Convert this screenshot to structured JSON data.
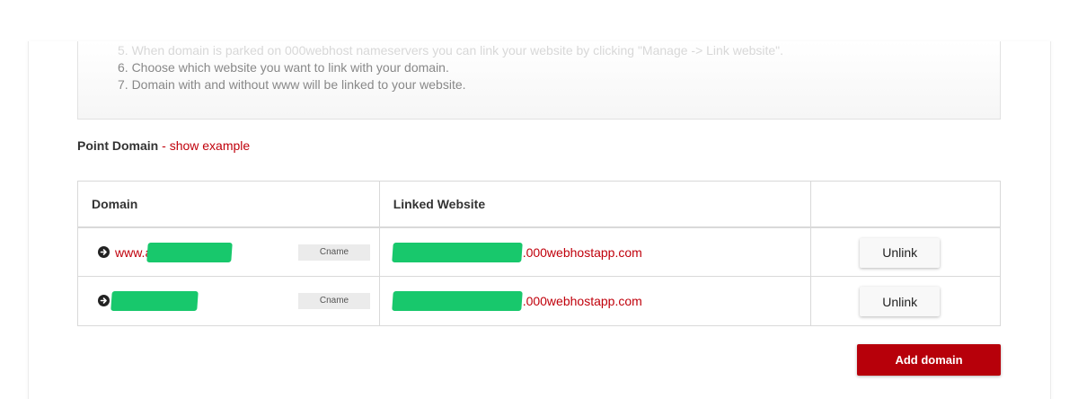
{
  "instructions": {
    "faded_step": "5. When domain is parked on 000webhost nameservers you can link your website by clicking \"Manage -> Link website\".",
    "steps": [
      "6. Choose which website you want to link with your domain.",
      "7. Domain with and without www will be linked to your website."
    ]
  },
  "point_domain": {
    "label": "Point Domain",
    "separator": " - ",
    "example_link": "show example"
  },
  "table": {
    "headers": [
      "Domain",
      "Linked Website",
      ""
    ],
    "rows": [
      {
        "domain_prefix": "www.a",
        "record_type": "Cname",
        "website_suffix": ".000webhostapp.com",
        "action": "Unlink"
      },
      {
        "domain_prefix": "",
        "record_type": "Cname",
        "website_suffix": ".000webhostapp.com",
        "action": "Unlink"
      }
    ]
  },
  "add_domain_label": "Add domain",
  "colors": {
    "accent": "#c0000b",
    "button_primary": "#b7000a",
    "redaction": "#18c86c"
  }
}
